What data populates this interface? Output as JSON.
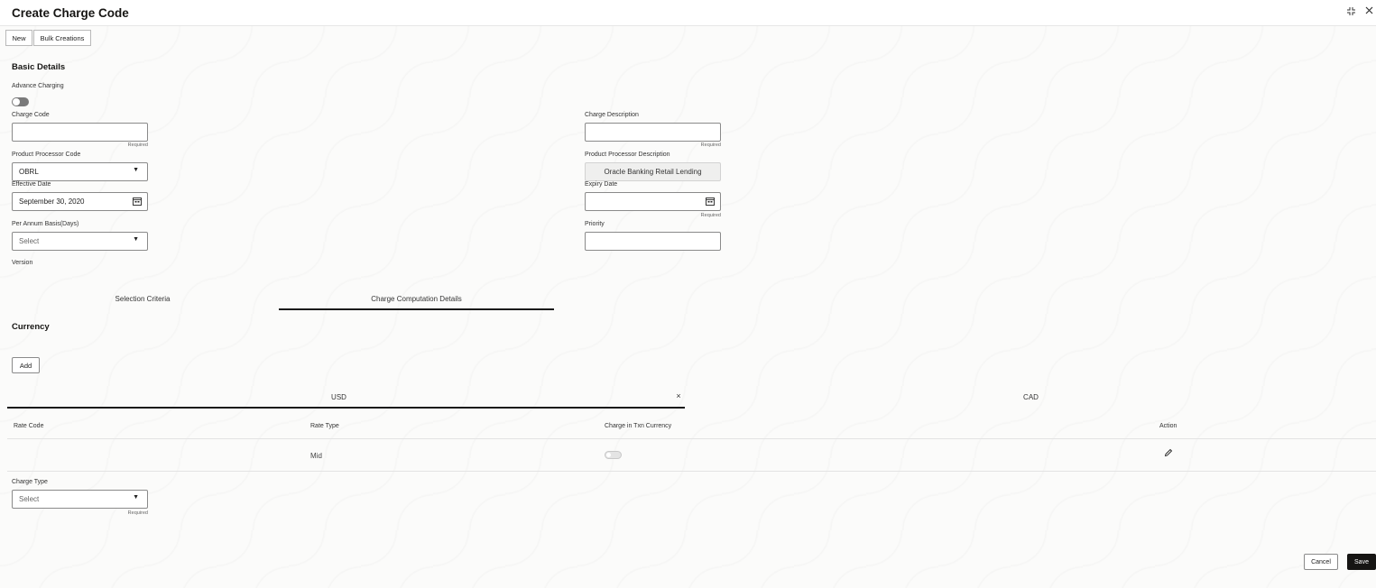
{
  "header": {
    "title": "Create Charge Code",
    "collapse_icon": "collapse-icon",
    "close_icon": "close-icon"
  },
  "toolbar": {
    "new_label": "New",
    "bulk_label": "Bulk Creations"
  },
  "basic_details": {
    "title": "Basic Details",
    "advance_charging_label": "Advance Charging",
    "advance_charging_on": false,
    "charge_code": {
      "label": "Charge Code",
      "value": "",
      "required": "Required"
    },
    "charge_description": {
      "label": "Charge Description",
      "value": "",
      "required": "Required"
    },
    "product_processor_code": {
      "label": "Product Processor Code",
      "value": "OBRL"
    },
    "product_processor_description": {
      "label": "Product Processor Description",
      "value": "Oracle Banking Retail Lending"
    },
    "effective_date": {
      "label": "Effective Date",
      "value": "September 30, 2020"
    },
    "expiry_date": {
      "label": "Expiry Date",
      "value": "",
      "required": "Required"
    },
    "per_annum_basis": {
      "label": "Per Annum Basis(Days)",
      "value": "Select"
    },
    "priority": {
      "label": "Priority",
      "value": ""
    },
    "version_label": "Version"
  },
  "main_tabs": [
    {
      "label": "Selection Criteria",
      "active": false
    },
    {
      "label": "Charge Computation Details",
      "active": true
    }
  ],
  "currency": {
    "title": "Currency",
    "add_label": "Add",
    "tabs": [
      {
        "label": "USD",
        "active": true,
        "close": "×"
      },
      {
        "label": "CAD",
        "active": false
      }
    ]
  },
  "rate_table": {
    "headers": [
      "Rate Code",
      "Rate Type",
      "Charge in Txn Currency",
      "Action"
    ],
    "rows": [
      {
        "rate_code": "",
        "rate_type": "Mid",
        "charge_in_txn_currency": false,
        "action_icon": "edit-pencil-icon"
      }
    ]
  },
  "charge_type": {
    "label": "Charge Type",
    "value": "Select",
    "required": "Required"
  },
  "footer": {
    "cancel_label": "Cancel",
    "save_label": "Save"
  },
  "colors": {
    "save_bg": "#161513",
    "tab_underline": "#1a1a1a"
  }
}
